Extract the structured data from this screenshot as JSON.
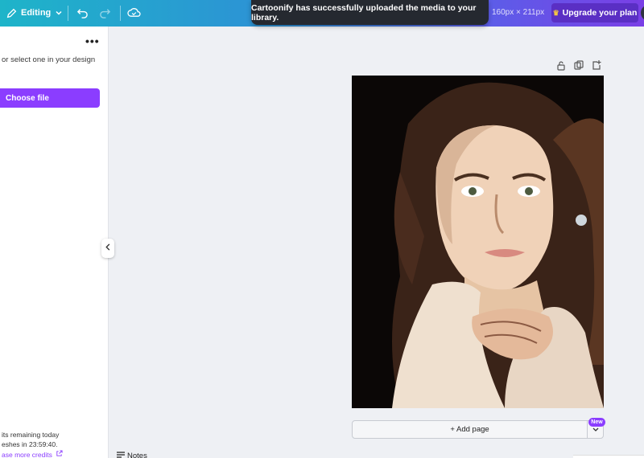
{
  "topbar": {
    "editing_label": "Editing",
    "dimensions": "160px × 211px",
    "upgrade_label": "Upgrade your plan"
  },
  "toast": {
    "message": "Cartoonify has successfully uploaded the media to your library."
  },
  "panel": {
    "description": "or select one in your design",
    "choose_file_label": "Choose file",
    "credits_remaining": "its remaining today",
    "refresh_text": "eshes in  23:59:40.",
    "purchase_link": "ase more credits"
  },
  "canvas": {
    "add_page_label": "+ Add page",
    "new_badge": "New",
    "notes_label": "Notes"
  },
  "colors": {
    "accent": "#8b3dff",
    "upgrade_bg": "#5a2fc4",
    "toast_bg": "#252930"
  }
}
